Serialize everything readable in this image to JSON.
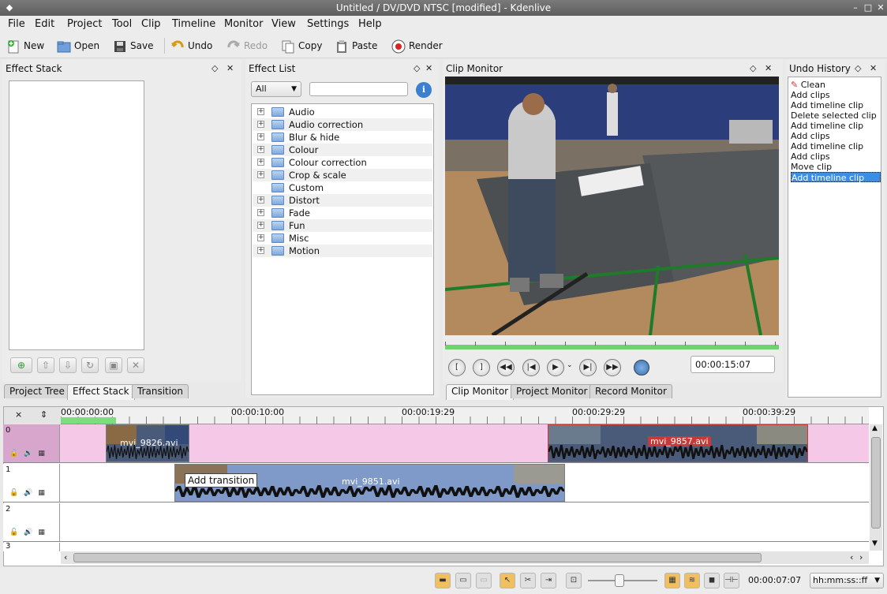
{
  "window": {
    "title": "Untitled / DV/DVD NTSC [modified] - Kdenlive"
  },
  "menu": [
    "File",
    "Edit",
    "Project",
    "Tool",
    "Clip",
    "Timeline",
    "Monitor",
    "View",
    "Settings",
    "Help"
  ],
  "toolbar": {
    "new": "New",
    "open": "Open",
    "save": "Save",
    "undo": "Undo",
    "redo": "Redo",
    "copy": "Copy",
    "paste": "Paste",
    "render": "Render"
  },
  "effect_stack": {
    "title": "Effect Stack"
  },
  "effect_list": {
    "title": "Effect List",
    "filter": "All",
    "categories": [
      "Audio",
      "Audio correction",
      "Blur & hide",
      "Colour",
      "Colour correction",
      "Crop & scale",
      "Custom",
      "Distort",
      "Fade",
      "Fun",
      "Misc",
      "Motion"
    ]
  },
  "clip_monitor": {
    "title": "Clip Monitor",
    "timecode": "00:00:15:07"
  },
  "undo_history": {
    "title": "Undo History",
    "items": [
      "Clean",
      "Add clips",
      "Add timeline clip",
      "Delete selected clip",
      "Add timeline clip",
      "Add clips",
      "Add timeline clip",
      "Add clips",
      "Move clip",
      "Add timeline clip"
    ],
    "selected_index": 9
  },
  "left_tabs": [
    "Project Tree",
    "Effect Stack",
    "Transition"
  ],
  "monitor_tabs": [
    "Clip Monitor",
    "Project Monitor",
    "Record Monitor"
  ],
  "timeline": {
    "ruler": [
      "00:00:00:00",
      "00:00:10:00",
      "00:00:19:29",
      "00:00:29:29",
      "00:00:39:29"
    ],
    "tracks": [
      "0",
      "1",
      "2",
      "3"
    ],
    "clips": [
      {
        "name": "mvi_9826.avi"
      },
      {
        "name": "mvi_9857.avi"
      },
      {
        "name": "mvi_9851.avi"
      }
    ],
    "tooltip": "Add transition"
  },
  "statusbar": {
    "timecode": "00:00:07:07",
    "format": "hh:mm:ss::ff"
  },
  "colors": {
    "selection": "#3a8ee6",
    "track_selected": "#f6c8e8",
    "clip_red": "#c83a3a"
  }
}
